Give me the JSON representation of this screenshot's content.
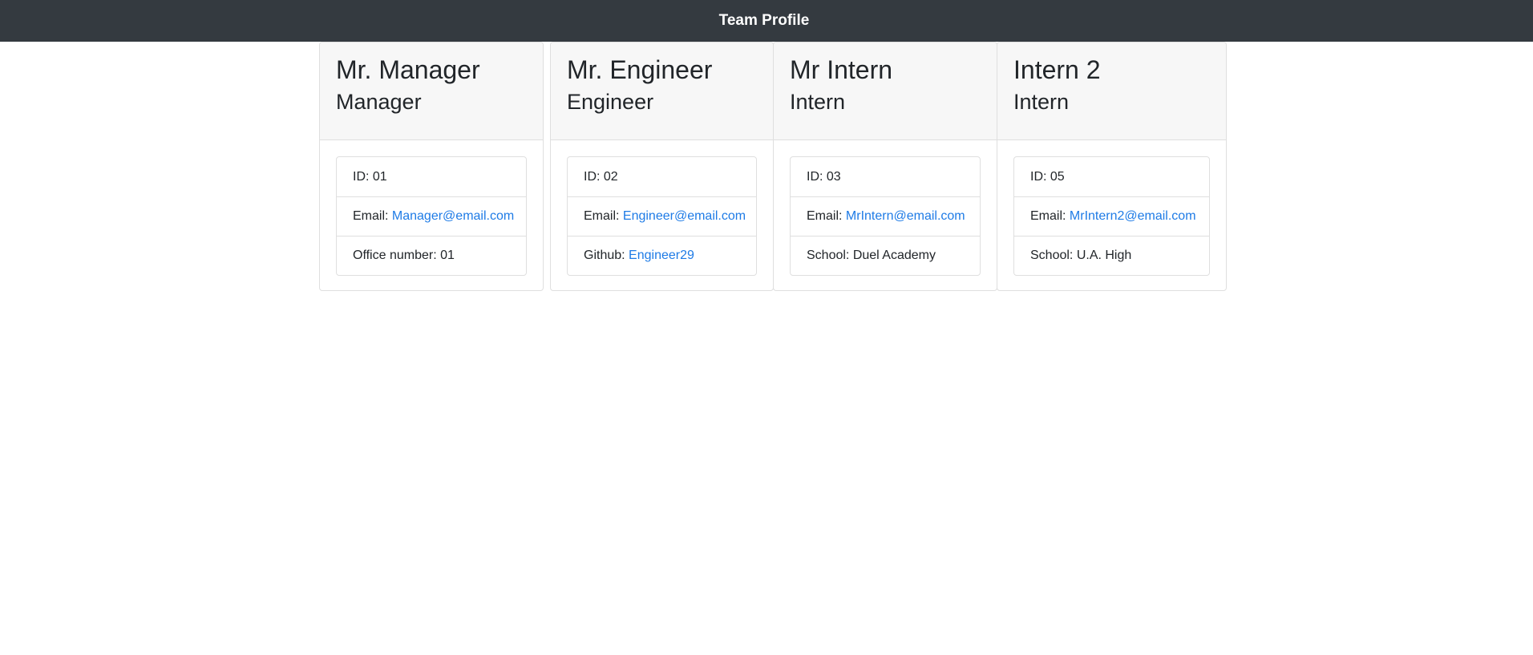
{
  "navbar": {
    "title": "Team Profile"
  },
  "cards": [
    {
      "name": "Mr. Manager",
      "role": "Manager",
      "id_text": "ID: 01",
      "email_label": "Email: ",
      "email": "Manager@email.com",
      "extra_label": "Office number: 01",
      "extra_link": ""
    },
    {
      "name": "Mr. Engineer",
      "role": "Engineer",
      "id_text": "ID: 02",
      "email_label": "Email: ",
      "email": "Engineer@email.com",
      "extra_label": "Github: ",
      "extra_link": "Engineer29"
    },
    {
      "name": "Mr Intern",
      "role": "Intern",
      "id_text": "ID: 03",
      "email_label": "Email: ",
      "email": "MrIntern@email.com",
      "extra_label": "School: Duel Academy",
      "extra_link": ""
    },
    {
      "name": "Intern 2",
      "role": "Intern",
      "id_text": "ID: 05",
      "email_label": "Email: ",
      "email": "MrIntern2@email.com",
      "extra_label": "School: U.A. High",
      "extra_link": ""
    }
  ],
  "colors": {
    "navbar_bg": "#343a40",
    "link": "#1e7be6",
    "header_bg": "#f7f7f7"
  }
}
